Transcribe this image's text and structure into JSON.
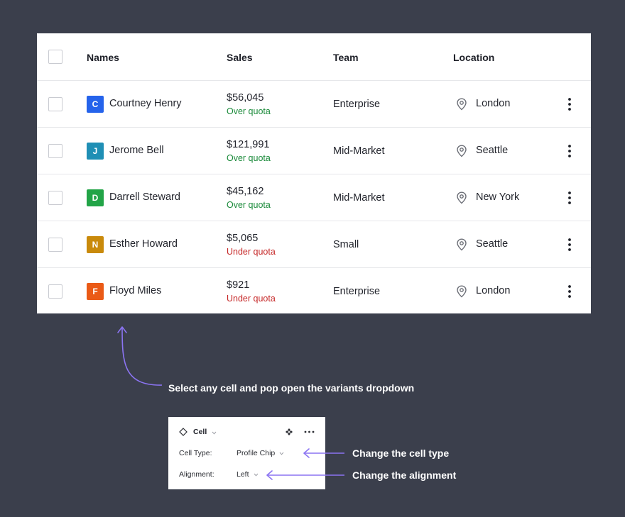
{
  "table": {
    "headers": {
      "names": "Names",
      "sales": "Sales",
      "team": "Team",
      "location": "Location"
    },
    "rows": [
      {
        "initial": "C",
        "avatar_color": "#2563eb",
        "name": "Courtney Henry",
        "sales": "$56,045",
        "status": "Over quota",
        "status_color": "#1a8a3a",
        "team": "Enterprise",
        "location": "London"
      },
      {
        "initial": "J",
        "avatar_color": "#1f8fb5",
        "name": "Jerome Bell",
        "sales": "$121,991",
        "status": "Over quota",
        "status_color": "#1a8a3a",
        "team": "Mid-Market",
        "location": "Seattle"
      },
      {
        "initial": "D",
        "avatar_color": "#22a447",
        "name": "Darrell Steward",
        "sales": "$45,162",
        "status": "Over quota",
        "status_color": "#1a8a3a",
        "team": "Mid-Market",
        "location": "New York"
      },
      {
        "initial": "N",
        "avatar_color": "#c98a0b",
        "name": "Esther Howard",
        "sales": "$5,065",
        "status": "Under quota",
        "status_color": "#c62828",
        "team": "Small",
        "location": "Seattle"
      },
      {
        "initial": "F",
        "avatar_color": "#ea5a16",
        "name": "Floyd Miles",
        "sales": "$921",
        "status": "Under quota",
        "status_color": "#c62828",
        "team": "Enterprise",
        "location": "London"
      }
    ]
  },
  "annotations": {
    "select_cell": "Select any cell and pop open the variants dropdown",
    "change_type": "Change the cell type",
    "change_alignment": "Change the alignment",
    "arrow_color": "#8b74f2"
  },
  "panel": {
    "title": "Cell",
    "cell_type_label": "Cell Type:",
    "cell_type_value": "Profile Chip",
    "alignment_label": "Alignment:",
    "alignment_value": "Left"
  }
}
